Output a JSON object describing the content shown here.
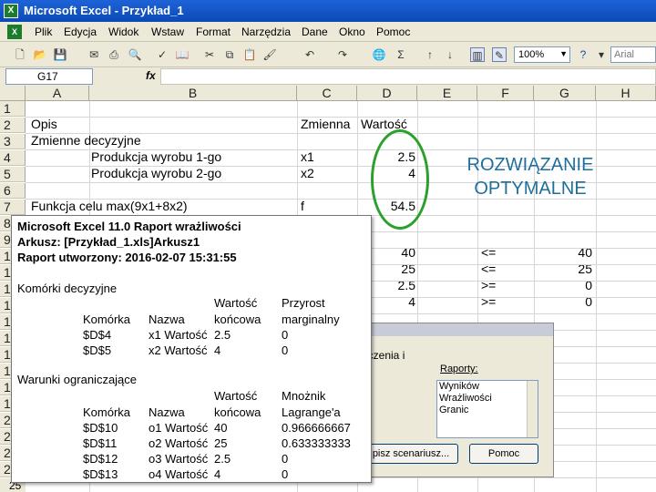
{
  "window": {
    "title": "Microsoft Excel - Przykład_1"
  },
  "menu": [
    "Plik",
    "Edycja",
    "Widok",
    "Wstaw",
    "Format",
    "Narzędzia",
    "Dane",
    "Okno",
    "Pomoc"
  ],
  "toolbar": {
    "zoom": "100%",
    "font": "Arial"
  },
  "formula_bar": {
    "name_box": "G17",
    "fx": "fx"
  },
  "columns": [
    "A",
    "B",
    "C",
    "D",
    "E",
    "F",
    "G",
    "H"
  ],
  "rows": [
    "1",
    "2",
    "3",
    "4",
    "5",
    "6",
    "7",
    "8",
    "9",
    "10",
    "11",
    "12",
    "13",
    "14",
    "15",
    "16",
    "17",
    "18",
    "19",
    "20",
    "21",
    "22",
    "23",
    "24",
    "25"
  ],
  "sheet": {
    "a2": "Opis",
    "a3": "Zmienne decyzyjne",
    "b4": "Produkcja wyrobu 1-go",
    "b5": "Produkcja wyrobu 2-go",
    "a7": "Funkcja celu max(9x1+8x2)",
    "c2": "Zmienna",
    "d2": "Wartość",
    "c4": "x1",
    "c5": "x2",
    "c7": "f",
    "d4": "2.5",
    "d5": "4",
    "d7": "54.5",
    "constraints": [
      {
        "d": "40",
        "f": "<=",
        "g": "40"
      },
      {
        "d": "25",
        "f": "<=",
        "g": "25"
      },
      {
        "d": "2.5",
        "f": ">=",
        "g": "0"
      },
      {
        "d": "4",
        "f": ">=",
        "g": "0"
      }
    ]
  },
  "annotation": {
    "line1": "ROZWIĄZANIE",
    "line2": "OPTYMALNE",
    "color": "#1f6f9e",
    "ellipse_color": "#2ca02c"
  },
  "dialog": {
    "clipped_text": "iczenia i",
    "group_label": "Raporty:",
    "reports": [
      "Wyników",
      "Wrażliwości",
      "Granic"
    ],
    "scenario_button": "pisz scenariusz...",
    "help_button": "Pomoc"
  },
  "report": {
    "title": "Microsoft Excel 11.0 Raport wrażliwości",
    "sheet_line": "Arkusz: [Przykład_1.xls]Arkusz1",
    "created_line": "Raport utworzony: 2016-02-07 15:31:55",
    "decision_section": "Komórki decyzyjne",
    "decision_headers": {
      "h1_top": "Wartość",
      "h2_top": "Przyrost",
      "cell": "Komórka",
      "name": "Nazwa",
      "h1_bottom": "końcowa",
      "h2_bottom": "marginalny"
    },
    "decision_rows": [
      {
        "cell": "$D$4",
        "name": "x1 Wartość",
        "value": "2.5",
        "marginal": "0"
      },
      {
        "cell": "$D$5",
        "name": "x2 Wartość",
        "value": "4",
        "marginal": "0"
      }
    ],
    "constraint_section": "Warunki ograniczające",
    "constraint_headers": {
      "h1_top": "Wartość",
      "h2_top": "Mnożnik",
      "cell": "Komórka",
      "name": "Nazwa",
      "h1_bottom": "końcowa",
      "h2_bottom": "Lagrange'a"
    },
    "constraint_rows": [
      {
        "cell": "$D$10",
        "name": "o1 Wartość",
        "value": "40",
        "mult": "0.966666667"
      },
      {
        "cell": "$D$11",
        "name": "o2 Wartość",
        "value": "25",
        "mult": "0.633333333"
      },
      {
        "cell": "$D$12",
        "name": "o3 Wartość",
        "value": "2.5",
        "mult": "0"
      },
      {
        "cell": "$D$13",
        "name": "o4 Wartość",
        "value": "4",
        "mult": "0"
      }
    ]
  }
}
